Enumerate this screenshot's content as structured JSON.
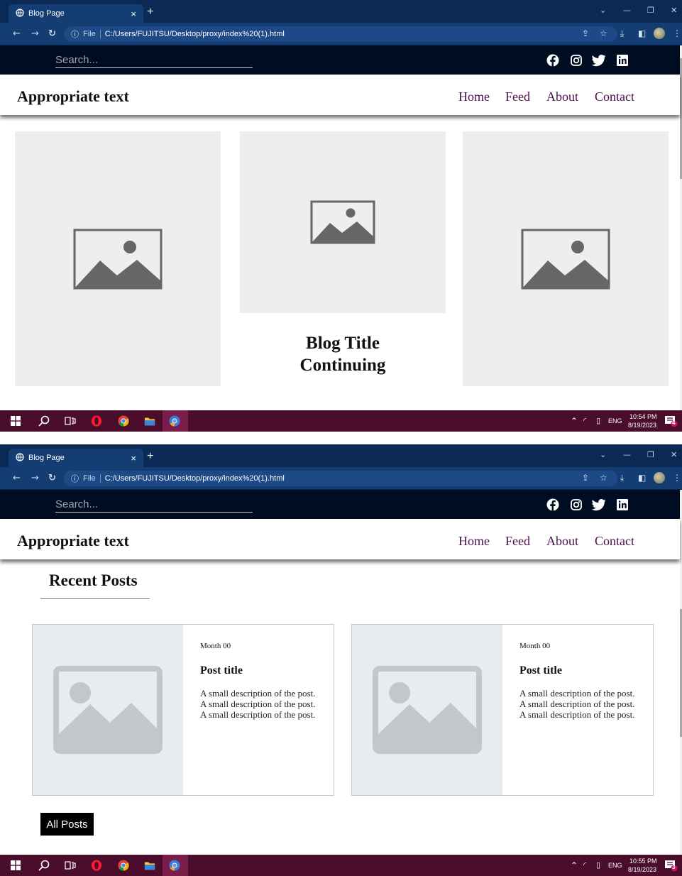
{
  "browser": {
    "tab_title": "Blog Page",
    "tab_close": "×",
    "new_tab": "+",
    "file_label": "File",
    "url": "C:/Users/FUJITSU/Desktop/proxy/index%20(1).html",
    "window_controls": [
      "chevron-down-icon",
      "minimize-icon",
      "restore-icon",
      "close-icon"
    ]
  },
  "topbar": {
    "search_placeholder": "Search...",
    "social": [
      "facebook-icon",
      "instagram-icon",
      "twitter-icon",
      "linkedin-icon"
    ]
  },
  "navbar": {
    "brand": "Appropriate text",
    "links": [
      "Home",
      "Feed",
      "About",
      "Contact"
    ]
  },
  "hero": {
    "blog_title_line1": "Blog Title",
    "blog_title_line2": "Continuing"
  },
  "recent": {
    "title": "Recent Posts",
    "posts": [
      {
        "date": "Month 00",
        "title": "Post title",
        "description": "A small description of the post. A small description of the post. A small description of the post."
      },
      {
        "date": "Month 00",
        "title": "Post title",
        "description": "A small description of the post. A small description of the post. A small description of the post."
      }
    ],
    "all_posts_label": "All Posts"
  },
  "taskbar": {
    "apps": [
      "windows-icon",
      "search-icon",
      "task-view-icon",
      "opera-icon",
      "chrome-icon",
      "file-explorer-icon",
      "chrome-canary-icon"
    ],
    "lang": "ENG",
    "shot1_time": "10:54 PM",
    "shot1_date": "8/19/2023",
    "shot1_notifications": "4",
    "shot2_time": "10:55 PM",
    "shot2_date": "8/19/2023",
    "shot2_notifications": "3"
  },
  "colors": {
    "topbar_bg": "#000c22",
    "nav_link": "#4b0f4e",
    "taskbar_bg": "#4a0d2c",
    "chrome_bg": "#0a2a55"
  }
}
